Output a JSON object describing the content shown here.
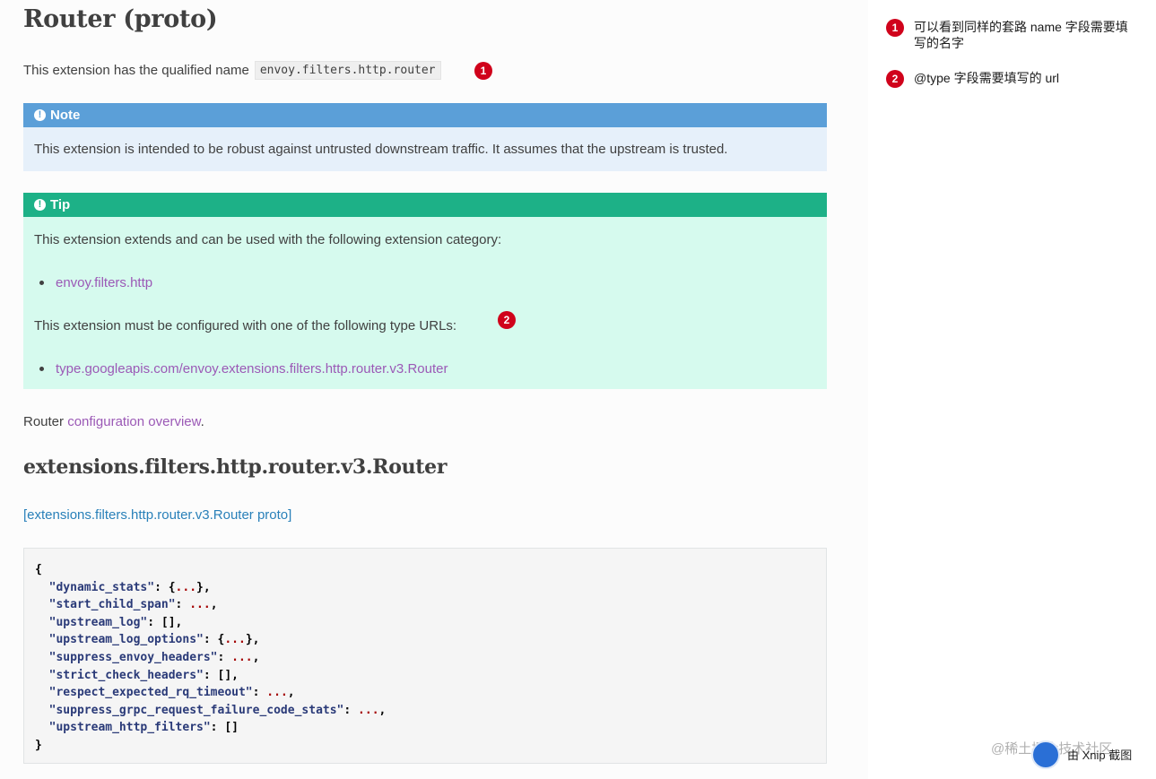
{
  "page": {
    "title": "Router (proto)",
    "qualified_prefix": "This extension has the qualified name",
    "qualified_name": "envoy.filters.http.router",
    "badge1": "1",
    "badge2": "2"
  },
  "note": {
    "title": "Note",
    "icon": "exclamation-circle-icon",
    "body": "This extension is intended to be robust against untrusted downstream traffic. It assumes that the upstream is trusted."
  },
  "tip": {
    "title": "Tip",
    "icon": "exclamation-circle-icon",
    "category_text": "This extension extends and can be used with the following extension category:",
    "category_link": "envoy.filters.http",
    "type_text": "This extension must be configured with one of the following type URLs:",
    "type_link": "type.googleapis.com/envoy.extensions.filters.http.router.v3.Router"
  },
  "router_line": {
    "prefix": "Router",
    "link": "configuration overview",
    "suffix": "."
  },
  "section": {
    "title": "extensions.filters.http.router.v3.Router",
    "proto_link": "[extensions.filters.http.router.v3.Router proto]"
  },
  "code": {
    "open": "{",
    "close": "}",
    "lines": [
      {
        "key": "\"dynamic_stats\"",
        "sep": ": ",
        "pre": "{",
        "dots": "...",
        "post": "},"
      },
      {
        "key": "\"start_child_span\"",
        "sep": ": ",
        "pre": "",
        "dots": "...",
        "post": ","
      },
      {
        "key": "\"upstream_log\"",
        "sep": ": ",
        "pre": "[],",
        "dots": "",
        "post": ""
      },
      {
        "key": "\"upstream_log_options\"",
        "sep": ": ",
        "pre": "{",
        "dots": "...",
        "post": "},"
      },
      {
        "key": "\"suppress_envoy_headers\"",
        "sep": ": ",
        "pre": "",
        "dots": "...",
        "post": ","
      },
      {
        "key": "\"strict_check_headers\"",
        "sep": ": ",
        "pre": "[],",
        "dots": "",
        "post": ""
      },
      {
        "key": "\"respect_expected_rq_timeout\"",
        "sep": ": ",
        "pre": "",
        "dots": "...",
        "post": ","
      },
      {
        "key": "\"suppress_grpc_request_failure_code_stats\"",
        "sep": ": ",
        "pre": "",
        "dots": "...",
        "post": ","
      },
      {
        "key": "\"upstream_http_filters\"",
        "sep": ": ",
        "pre": "[]",
        "dots": "",
        "post": ""
      }
    ]
  },
  "annotations": [
    {
      "num": "1",
      "text": "可以看到同样的套路 name 字段需要填写的名字"
    },
    {
      "num": "2",
      "text": "@type 字段需要填写的 url"
    }
  ],
  "watermark": {
    "text": "@稀土掘金技术社区",
    "xnip": "由 Xnip 截图"
  },
  "colors": {
    "note_header": "#5b9fd8",
    "note_body": "#e6f0fa",
    "tip_header": "#1db187",
    "tip_body": "#d6faee",
    "link": "#9b59b6",
    "proto_link": "#2980b9",
    "badge": "#d0021b"
  }
}
